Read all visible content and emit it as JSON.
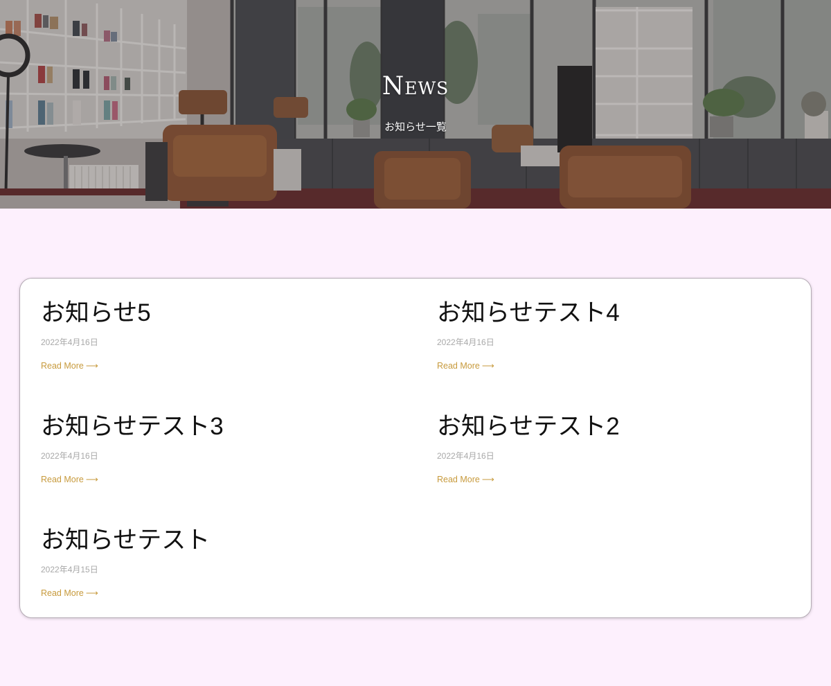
{
  "hero": {
    "title": "News",
    "subtitle": "お知らせ一覧"
  },
  "posts": [
    {
      "title": "お知らせ5",
      "date": "2022年4月16日",
      "link": "Read More",
      "arrow": "⟶"
    },
    {
      "title": "お知らせテスト4",
      "date": "2022年4月16日",
      "link": "Read More",
      "arrow": "⟶"
    },
    {
      "title": "お知らせテスト3",
      "date": "2022年4月16日",
      "link": "Read More",
      "arrow": "⟶"
    },
    {
      "title": "お知らせテスト2",
      "date": "2022年4月16日",
      "link": "Read More",
      "arrow": "⟶"
    },
    {
      "title": "お知らせテスト",
      "date": "2022年4月15日",
      "link": "Read More",
      "arrow": "⟶"
    }
  ],
  "colors": {
    "page_background": "#fdf0fd",
    "link": "#c79a3c",
    "date": "#a8a8a8",
    "title": "#111111"
  }
}
